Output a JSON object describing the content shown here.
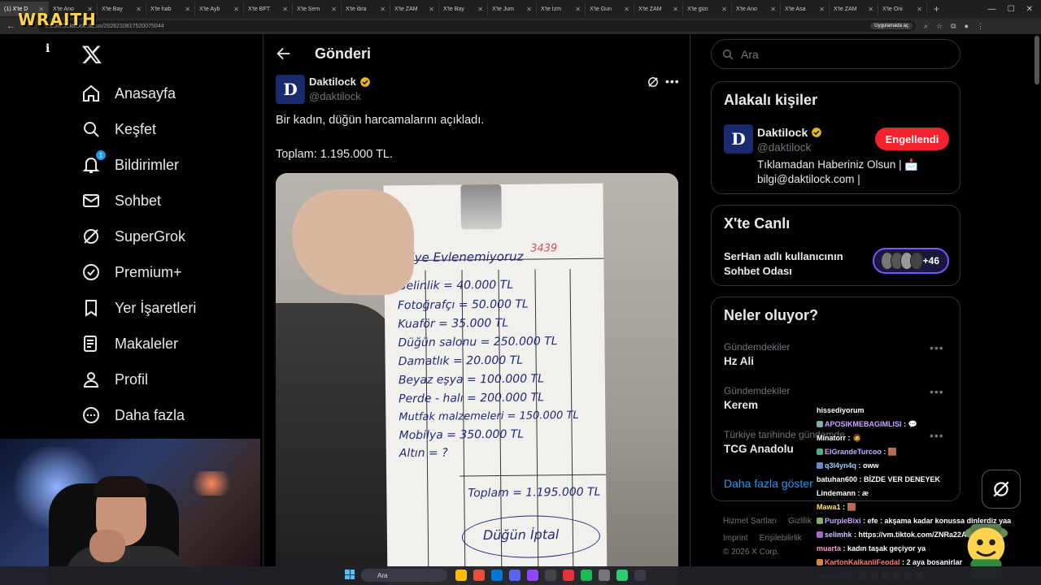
{
  "browser": {
    "tabs": [
      "(1) X'te D",
      "X'te Ano",
      "X'te Bay",
      "X'te hab",
      "X'te Ayb",
      "X'te BFT",
      "X'te Sem",
      "X'te ibra",
      "X'te ZAM",
      "X'te Bay",
      "X'te Jum",
      "X'te İzm",
      "X'te Gun",
      "X'te ZAM",
      "X'te gün",
      "X'te Ano",
      "X'te Asa",
      "X'te ZAM",
      "X'te Oni"
    ],
    "url": "x.com/Daktilock/status/2026210817520075044",
    "app_button": "Uygulamada aç",
    "overlay_logo": "WRAITH"
  },
  "sidebar": {
    "info_letter": "i",
    "notification_count": "1",
    "items": [
      {
        "label": "Anasayfa",
        "icon": "home-icon"
      },
      {
        "label": "Keşfet",
        "icon": "search-icon"
      },
      {
        "label": "Bildirimler",
        "icon": "bell-icon"
      },
      {
        "label": "Sohbet",
        "icon": "mail-icon"
      },
      {
        "label": "SuperGrok",
        "icon": "grok-icon"
      },
      {
        "label": "Premium+",
        "icon": "verified-badge-icon"
      },
      {
        "label": "Yer İşaretleri",
        "icon": "bookmark-icon"
      },
      {
        "label": "Makaleler",
        "icon": "article-icon"
      },
      {
        "label": "Profil",
        "icon": "person-icon"
      },
      {
        "label": "Daha fazla",
        "icon": "more-circle-icon"
      }
    ]
  },
  "post": {
    "header_title": "Gönderi",
    "author_name": "Daktilock",
    "author_handle": "@daktilock",
    "avatar_letter": "D",
    "text_line1": "Bir kadın, düğün harcamalarını açıkladı.",
    "text_line2": "Toplam: 1.195.000 TL.",
    "photo": {
      "note_title": "Niye Evlenemiyoruz",
      "note_number": "3439",
      "lines": [
        "Gelinlik = 40.000 TL",
        "Fotoğrafçı = 50.000 TL",
        "Kuaför = 35.000 TL",
        "Düğün salonu = 250.000 TL",
        "Damatlık = 20.000 TL",
        "Beyaz eşya = 100.000 TL",
        "Perde - halı = 200.000 TL",
        "Mutfak malzemeleri = 150.000 TL",
        "Mobilya = 350.000 TL",
        "Altın = ?"
      ],
      "total": "Toplam = 1.195.000 TL",
      "cancel": "Düğün İptal"
    }
  },
  "right": {
    "search_placeholder": "Ara",
    "related": {
      "title": "Alakalı kişiler",
      "name": "Daktilock",
      "handle": "@daktilock",
      "bio_line1": "Tıklamadan Haberiniz Olsun | 📩",
      "bio_line2": "bilgi@daktilock.com |",
      "button": "Engellendi"
    },
    "live": {
      "title": "X'te Canlı",
      "room": "SerHan adlı kullanıcının Sohbet Odası",
      "count": "+46"
    },
    "trends": {
      "title": "Neler oluyor?",
      "items": [
        {
          "category": "Gündemdekiler",
          "name": "Hz Ali"
        },
        {
          "category": "Gündemdekiler",
          "name": "Kerem"
        },
        {
          "category": "Türkiye tarihinde gündemde",
          "name": "TCG Anadolu"
        }
      ],
      "show_more": "Daha fazla göster"
    },
    "footer": {
      "links1": [
        "Hizmet Şartları",
        "Gizlilik"
      ],
      "links2": [
        "Imprint",
        "Erişilebilirlik"
      ],
      "copyright": "© 2026 X Corp."
    }
  },
  "chat": [
    {
      "user": "",
      "msg": "hissediyorum",
      "color": "#ffffff"
    },
    {
      "user": "APOSIKMEBAGIMLISI",
      "msg": ": 💬",
      "color": "#c9a8ff"
    },
    {
      "user": "Minatorr",
      "msg": ": 🧔",
      "color": "#ffffff"
    },
    {
      "user": "ElGrandeTurcoo",
      "msg": ": 🟫",
      "color": "#c9a8ff"
    },
    {
      "user": "q3l4yn4q",
      "msg": ": oww",
      "color": "#9ad2ff"
    },
    {
      "user": "batuhan600",
      "msg": ": BİZDE VER DENEYEK",
      "color": "#ffffff"
    },
    {
      "user": "Lindemann",
      "msg": ": æ",
      "color": "#ffffff"
    },
    {
      "user": "Mawa1",
      "msg": ": 🟫",
      "color": "#ffe07a"
    },
    {
      "user": "PurpleBixi",
      "msg": ": efe : akşama kadar konussa dinlerdiz yaa",
      "color": "#c9a8ff"
    },
    {
      "user": "selimhk",
      "msg": ": https://vm.tiktok.com/ZNRa22AQV/",
      "color": "#d6c5ff"
    },
    {
      "user": "muarta",
      "msg": ": kadın taşak geçiyor ya",
      "color": "#ff9ad0"
    },
    {
      "user": "KartonKalkanliFeodal",
      "msg": ": 2 aya bosanirlar",
      "color": "#ff7a7a"
    },
    {
      "user": "teneke000",
      "msg": ": 🟫 🟫 🟫 🟫 🟫 🟫",
      "color": "#9ad2ff"
    }
  ],
  "taskbar": {
    "search": "Ara"
  }
}
